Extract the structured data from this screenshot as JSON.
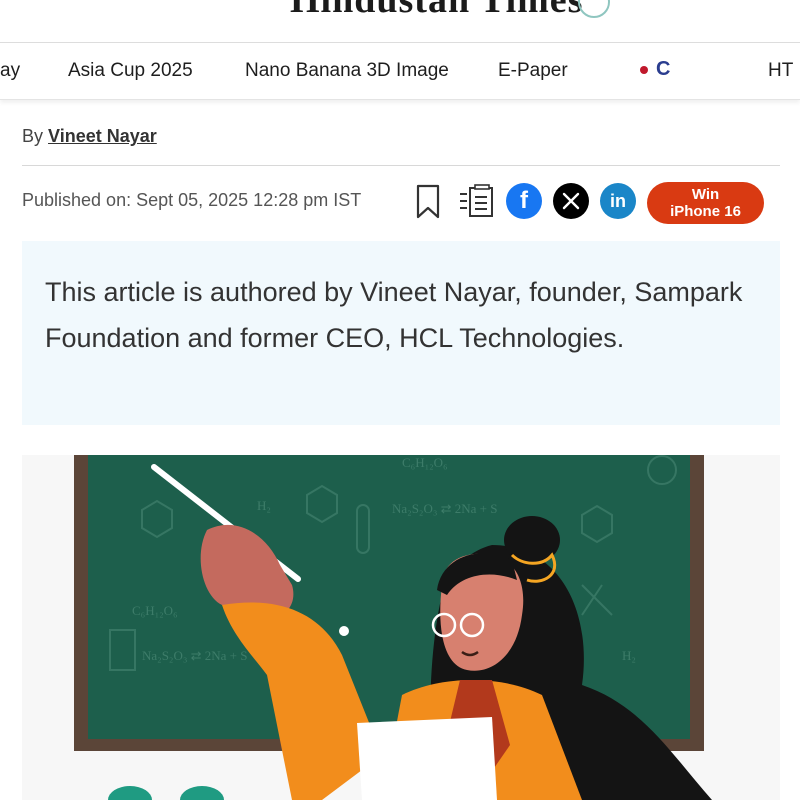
{
  "nav": {
    "items": [
      "ay",
      "Asia Cup 2025",
      "Nano Banana 3D Image",
      "E-Paper",
      "HT"
    ],
    "live_label": "C"
  },
  "article": {
    "byline_prefix": "By",
    "author": "Vineet Nayar",
    "published": "Published on: Sept 05, 2025 12:28 pm IST",
    "summary": "This article is authored by Vineet Nayar, founder, Sampark Foundation and former CEO, HCL Technologies."
  },
  "share": {
    "icons": [
      "bookmark-icon",
      "reader-mode-icon",
      "facebook-icon",
      "x-icon",
      "linkedin-icon"
    ],
    "promo_line1": "Win",
    "promo_line2": "iPhone 16"
  },
  "colors": {
    "promo": "#d93a12",
    "facebook": "#1877f2",
    "linkedin": "#1a86c8",
    "summary_bg": "#f1f9fd",
    "chalkboard": "#1d5f4c"
  }
}
